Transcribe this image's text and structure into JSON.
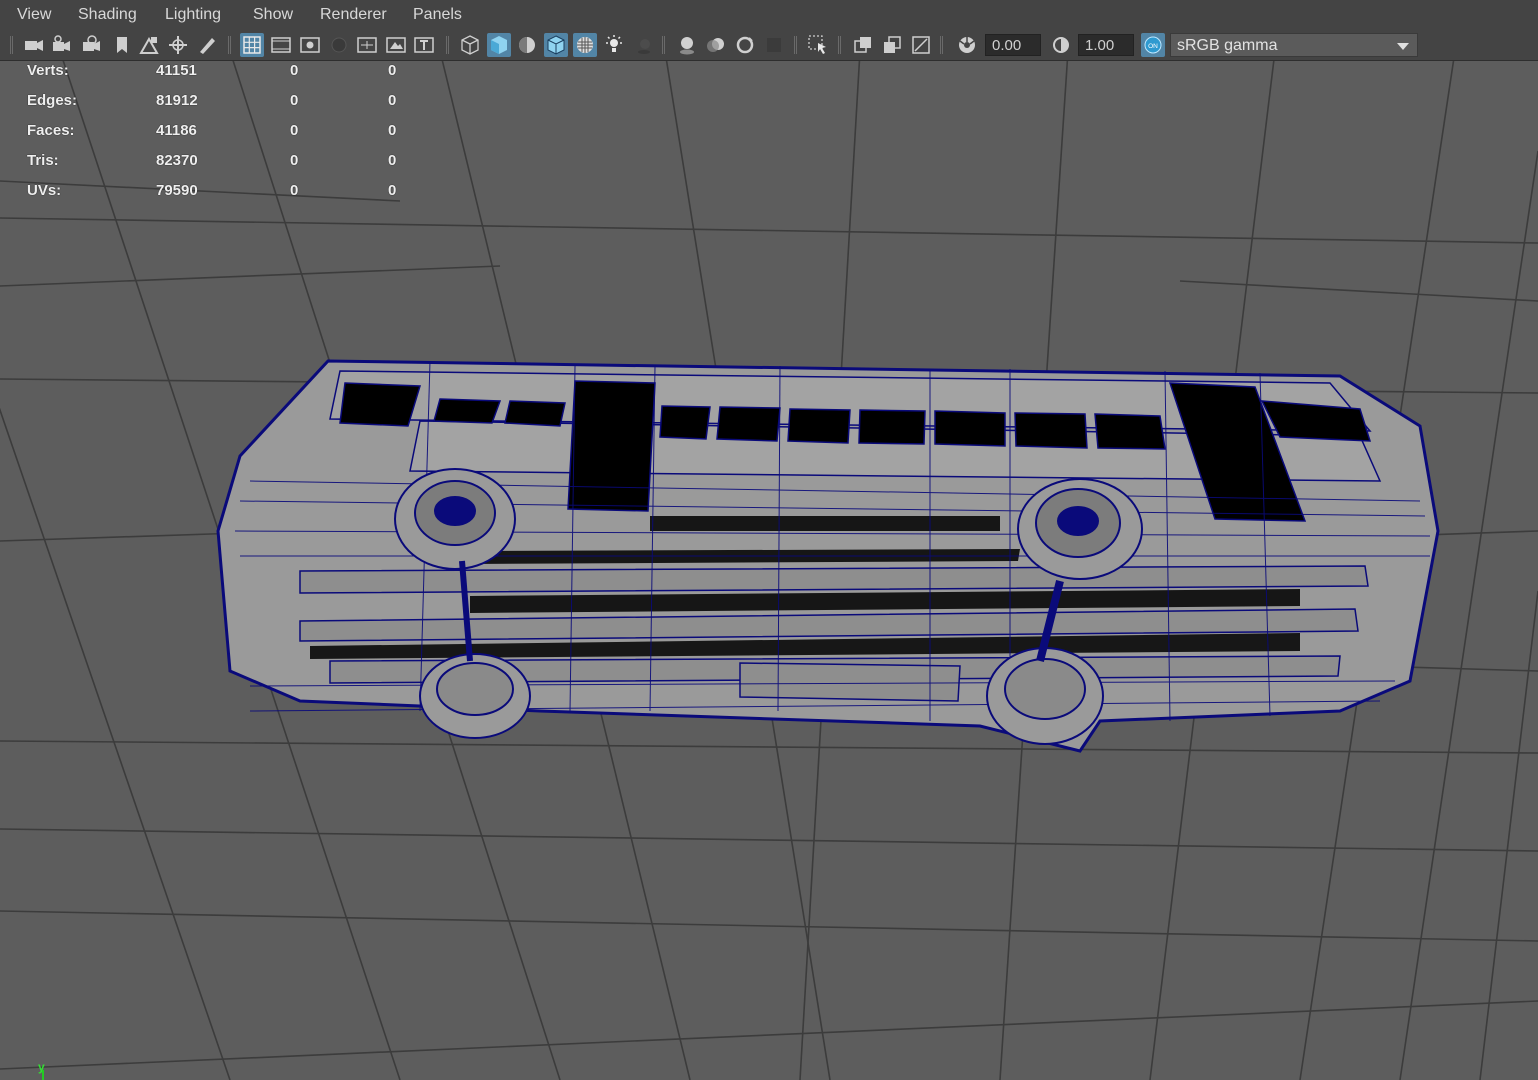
{
  "menubar": {
    "items": [
      "View",
      "Shading",
      "Lighting",
      "Show",
      "Renderer",
      "Panels"
    ]
  },
  "toolbar": {
    "icons": [
      "camera-icon",
      "camera-attributes-icon",
      "camera-bookmark-icon",
      "bookmark-icon",
      "image-plane-icon",
      "pan-zoom-icon",
      "grease-pencil-icon",
      "grid-icon",
      "film-gate-icon",
      "resolution-gate-icon",
      "gate-mask-icon",
      "field-chart-icon",
      "safe-action-icon",
      "safe-title-icon",
      "wireframe-icon",
      "smooth-shade-icon",
      "default-material-icon",
      "wireframe-on-shaded-icon",
      "textured-icon",
      "use-all-lights-icon",
      "shadows-icon",
      "screen-space-ao-icon",
      "motion-blur-icon",
      "anti-aliasing-icon",
      "depth-of-field-icon",
      "isolate-select-icon",
      "xray-icon",
      "xray-active-components-icon",
      "xray-joints-icon",
      "exposure-icon",
      "gamma-icon",
      "color-management-icon"
    ],
    "exposure_value": "0.00",
    "gamma_value": "1.00",
    "color_space": "sRGB gamma",
    "active_icons": [
      "grid-icon",
      "smooth-shade-icon",
      "wireframe-on-shaded-icon",
      "color-management-icon"
    ]
  },
  "hud": {
    "rows": [
      {
        "label": "Verts:",
        "values": [
          "41151",
          "0",
          "0"
        ]
      },
      {
        "label": "Edges:",
        "values": [
          "81912",
          "0",
          "0"
        ]
      },
      {
        "label": "Faces:",
        "values": [
          "41186",
          "0",
          "0"
        ]
      },
      {
        "label": "Tris:",
        "values": [
          "82370",
          "0",
          "0"
        ]
      },
      {
        "label": "UVs:",
        "values": [
          "79590",
          "0",
          "0"
        ]
      }
    ]
  },
  "viewport": {
    "axis_label": "y",
    "background_color": "#5d5d5d",
    "grid_color": "#3a3a3a",
    "wire_color": "#0a0a7a",
    "mesh_fill_color": "#9a9a9a"
  }
}
